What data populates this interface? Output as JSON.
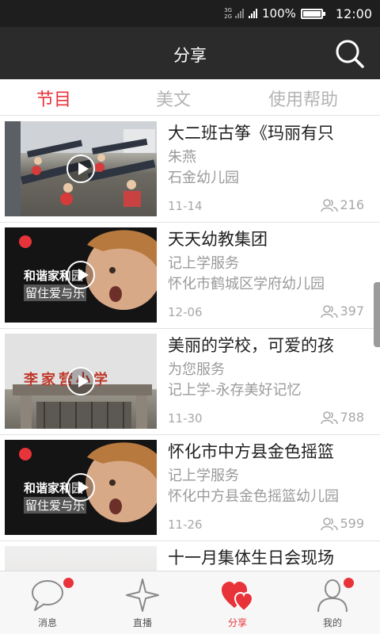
{
  "status": {
    "network_top": "3G",
    "network_bottom": "2G",
    "battery": "100%",
    "time": "12:00"
  },
  "header": {
    "title": "分享",
    "search_icon": "search-icon"
  },
  "tabs": [
    {
      "label": "节目",
      "active": true
    },
    {
      "label": "美文",
      "active": false
    },
    {
      "label": "使用帮助",
      "active": false
    }
  ],
  "items": [
    {
      "title": "大二班古筝《玛丽有只",
      "line1": "朱燕",
      "line2": "石金幼儿园",
      "date": "11-14",
      "views": "216"
    },
    {
      "title": "天天幼教集团",
      "line1": "记上学服务",
      "line2": "怀化市鹤城区学府幼儿园",
      "date": "12-06",
      "views": "397",
      "thumb_text1": "和谐家和园",
      "thumb_text2": "留住爱与乐"
    },
    {
      "title": "美丽的学校，可爱的孩",
      "line1": "为您服务",
      "line2": "记上学-永存美好记忆",
      "date": "11-30",
      "views": "788",
      "thumb_sign": "李家营小学"
    },
    {
      "title": "怀化市中方县金色摇篮",
      "line1": "记上学服务",
      "line2": "怀化中方县金色摇篮幼儿园",
      "date": "11-26",
      "views": "599",
      "thumb_text1": "和谐家和园",
      "thumb_text2": "留住爱与乐"
    },
    {
      "title": "十一月集体生日会现场",
      "line1": "",
      "line2": "",
      "date": "",
      "views": ""
    }
  ],
  "nav": [
    {
      "label": "消息",
      "icon": "message-bubble-icon",
      "badge": true
    },
    {
      "label": "直播",
      "icon": "star-icon",
      "badge": false
    },
    {
      "label": "分享",
      "icon": "hearts-icon",
      "badge": false,
      "active": true
    },
    {
      "label": "我的",
      "icon": "person-icon",
      "badge": true
    }
  ],
  "colors": {
    "accent": "#e8333a",
    "header_bg": "#2b2b2b",
    "status_bg": "#1e1e1e"
  }
}
